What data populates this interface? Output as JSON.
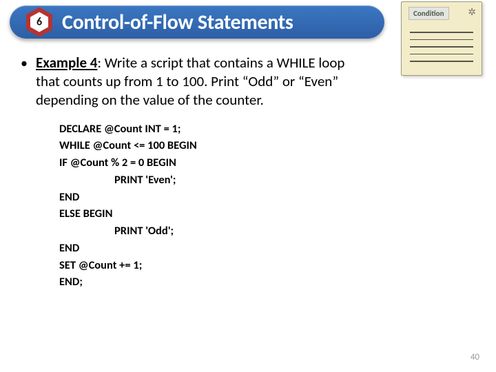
{
  "header": {
    "number": "6",
    "title": "Control-of-Flow Statements"
  },
  "note": {
    "label": "Condition"
  },
  "example": {
    "label": "Example 4",
    "text_part1": ": Write a script that contains a WHILE loop",
    "text_part2": "that counts up from 1 to 100. Print “Odd” or “Even”",
    "text_part3": "depending on the value of the counter."
  },
  "code": {
    "l1": "DECLARE @Count INT = 1;",
    "l2": "WHILE @Count <= 100 BEGIN",
    "l3": "IF @Count % 2 = 0 BEGIN",
    "l4": "PRINT 'Even';",
    "l5": "END",
    "l6": "ELSE BEGIN",
    "l7": "PRINT 'Odd';",
    "l8": "END",
    "l9": "SET @Count += 1;",
    "l10": "END;"
  },
  "page_number": "40"
}
